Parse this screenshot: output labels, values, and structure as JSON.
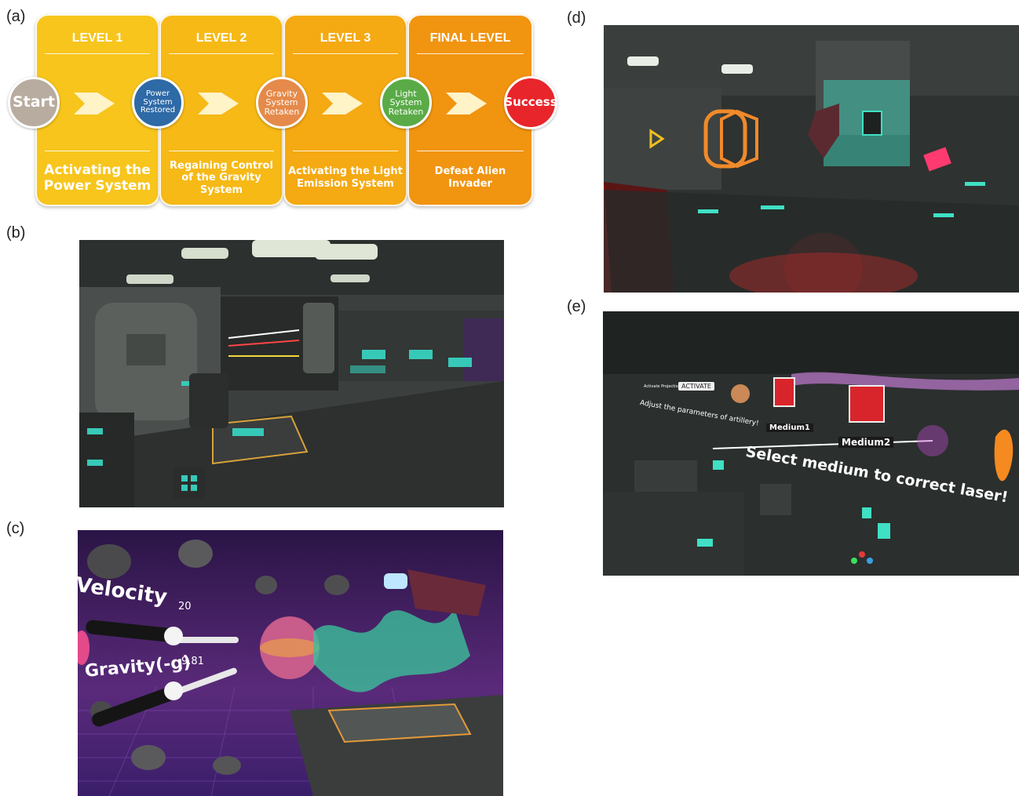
{
  "panel_labels": {
    "a": "(a)",
    "b": "(b)",
    "c": "(c)",
    "d": "(d)",
    "e": "(e)"
  },
  "flowchart": {
    "levels": [
      {
        "title": "LEVEL 1",
        "description": "Activating the Power System",
        "color": "#f7c51c"
      },
      {
        "title": "LEVEL 2",
        "description": "Regaining Control of the Gravity System",
        "color": "#f6b916"
      },
      {
        "title": "LEVEL 3",
        "description": "Activating the Light Emission System",
        "color": "#f5a912"
      },
      {
        "title": "FINAL LEVEL",
        "description": "Defeat Alien Invader",
        "color": "#f19410"
      }
    ],
    "nodes": [
      {
        "label": "Start",
        "color": "#b8aca0"
      },
      {
        "label": "Power System Restored",
        "color": "#2e6aa6"
      },
      {
        "label": "Gravity System Retaken",
        "color": "#e58a4a"
      },
      {
        "label": "Light System Retaken",
        "color": "#5aab47"
      },
      {
        "label": "Success",
        "color": "#e8252b"
      }
    ]
  },
  "scene_c": {
    "velocity_label": "Velocity",
    "velocity_value": "20",
    "gravity_label": "Gravity(-g)",
    "gravity_value": "9.81"
  },
  "scene_e": {
    "activate_button": "ACTIVATE",
    "hint_small": "Activate Projection Speed",
    "adjust_text": "Adjust the parameters of artillery!",
    "medium1_label": "Medium1",
    "medium2_label": "Medium2",
    "instruction": "Select medium to correct laser!"
  }
}
